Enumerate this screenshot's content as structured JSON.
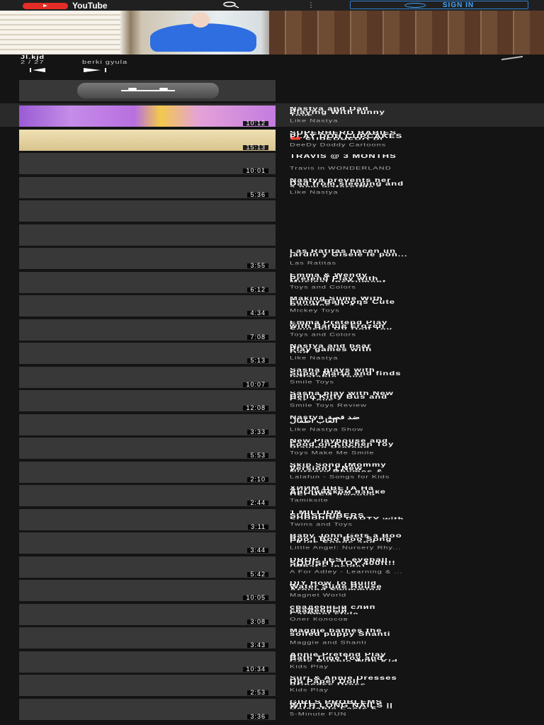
{
  "app": {
    "logo_text": "YouTube",
    "sign_in_label": "SIGN IN",
    "menu_glyph": "⋮"
  },
  "playlist": {
    "title": "Jl.kjd",
    "position": "2 / 27",
    "author": "berki gyula"
  },
  "colors": {
    "background": "#141414",
    "accent": "#3ea6ff",
    "brand_red": "#e52d27"
  },
  "videos": [
    {
      "title": "Nastya and Dad\nPlaying With funny\nToys",
      "channel": "Like Nastya",
      "duration": "10:12"
    },
    {
      "title": "SUPERHERO BABIES\nPLAY DOH CUPCAKES\n❤️ SUPERHERO PL...",
      "channel": "DeeDy Doddy Cartoons",
      "duration": "15:13"
    },
    {
      "title": "TRAVIS @ 3 MONTHS",
      "channel": "Travis in WONDERLAND",
      "duration": "10:01"
    },
    {
      "title": "Nastya prevents her\nDad from sleeping and\na new waterslide",
      "channel": "Like Nastya",
      "duration": "5:36"
    },
    {
      "title": "",
      "channel": "",
      "duration": ""
    },
    {
      "title": "",
      "channel": "",
      "duration": ""
    },
    {
      "title": "Las Ratitas hacen un\njardín y Gisele le pon...",
      "channel": "Las Ratitas",
      "duration": "3:55"
    },
    {
      "title": "Emma & Wendy\nPretend Play with\nMusical Instrument...",
      "channel": "Toys and Colors",
      "duration": "6:12"
    },
    {
      "title": "Making Slime With\nFunny Balloons Cute\nBoodles #1 4 1...",
      "channel": "Mickey Toys",
      "duration": "4:34"
    },
    {
      "title": "Emma Pretend Play\nwith Barbie Frozen\nSquishy RV Doll Toy",
      "channel": "Toys and Colors",
      "duration": "7:08"
    },
    {
      "title": "Nastya and bear\nPlay games with\nDad",
      "channel": "Like Nastya",
      "duration": "5:13"
    },
    {
      "title": "Sasha plays with\nSuper Mario and finds\nInflatable Toys..",
      "channel": "Smile Toys",
      "duration": "10:07"
    },
    {
      "title": "Sasha play with New\nHello Kitty Bus and\nCar Toys",
      "channel": "Smile Toys Review",
      "duration": "12:08"
    },
    {
      "title": "Nastya ضد قصة\nالعاب اطفال",
      "channel": "Like Nastya Show",
      "duration": "3:33"
    },
    {
      "title": "New Playhouse and\nFood on Kitchen Toy\nPlaying Pretend",
      "channel": "Toys Make Me Smile",
      "duration": "5:53"
    },
    {
      "title": "Skip Song (Mommy\nVersion) | New\nNursery Rhymes &...",
      "channel": "Lalafun - Songs for Kids",
      "duration": "2:10"
    },
    {
      "title": "ХИИМ ЦВЕТА На\nАнглийском языке\nПЕСНЕЙ Джонни...",
      "channel": "Tamiksite",
      "duration": "2:44"
    },
    {
      "title": "1 MILLION\nSUBSCRIBERS\nSURPRISE PARTY with...",
      "channel": "Twins and Toys",
      "duration": "3:11"
    },
    {
      "title": "Baby John Gets a Boo\nBoo | Boo Boo Song\n| Kids Songs and...",
      "channel": "Little Angel: Nursery Rhy...",
      "duration": "3:44"
    },
    {
      "title": "DROP TEST eyeball\nSQUISHY TOY 400ft!!\n(What's inside)",
      "channel": "A For Adley - Learning & ...",
      "duration": "5:42"
    },
    {
      "title": "DIY How To Build\nWater Slide House\nAround Swimming...",
      "channel": "Magnet World",
      "duration": "10:05"
    },
    {
      "title": "свадебный слип\nсвадебный\nCaramel style",
      "channel": "Олег Колосов",
      "duration": "3:08"
    },
    {
      "title": "Maggie bathes the\nsoiled puppy Shanti",
      "channel": "Maggie and Shanti",
      "duration": "3:43"
    },
    {
      "title": "Annie Pretend Play\nBath Time Toy and\nGets Bubble With Kid...",
      "channel": "Kids Play",
      "duration": "10:34"
    },
    {
      "title": "Suri & Annie Dresses\nUp Paper Doll\nPrincess Dress",
      "channel": "Kids Play",
      "duration": "2:53"
    },
    {
      "title": "GIRLS PROBLEMS\nWITH LONG NAILS ||\nRelatable Facts 5...",
      "channel": "5-Minute FUN",
      "duration": "3:36"
    }
  ]
}
